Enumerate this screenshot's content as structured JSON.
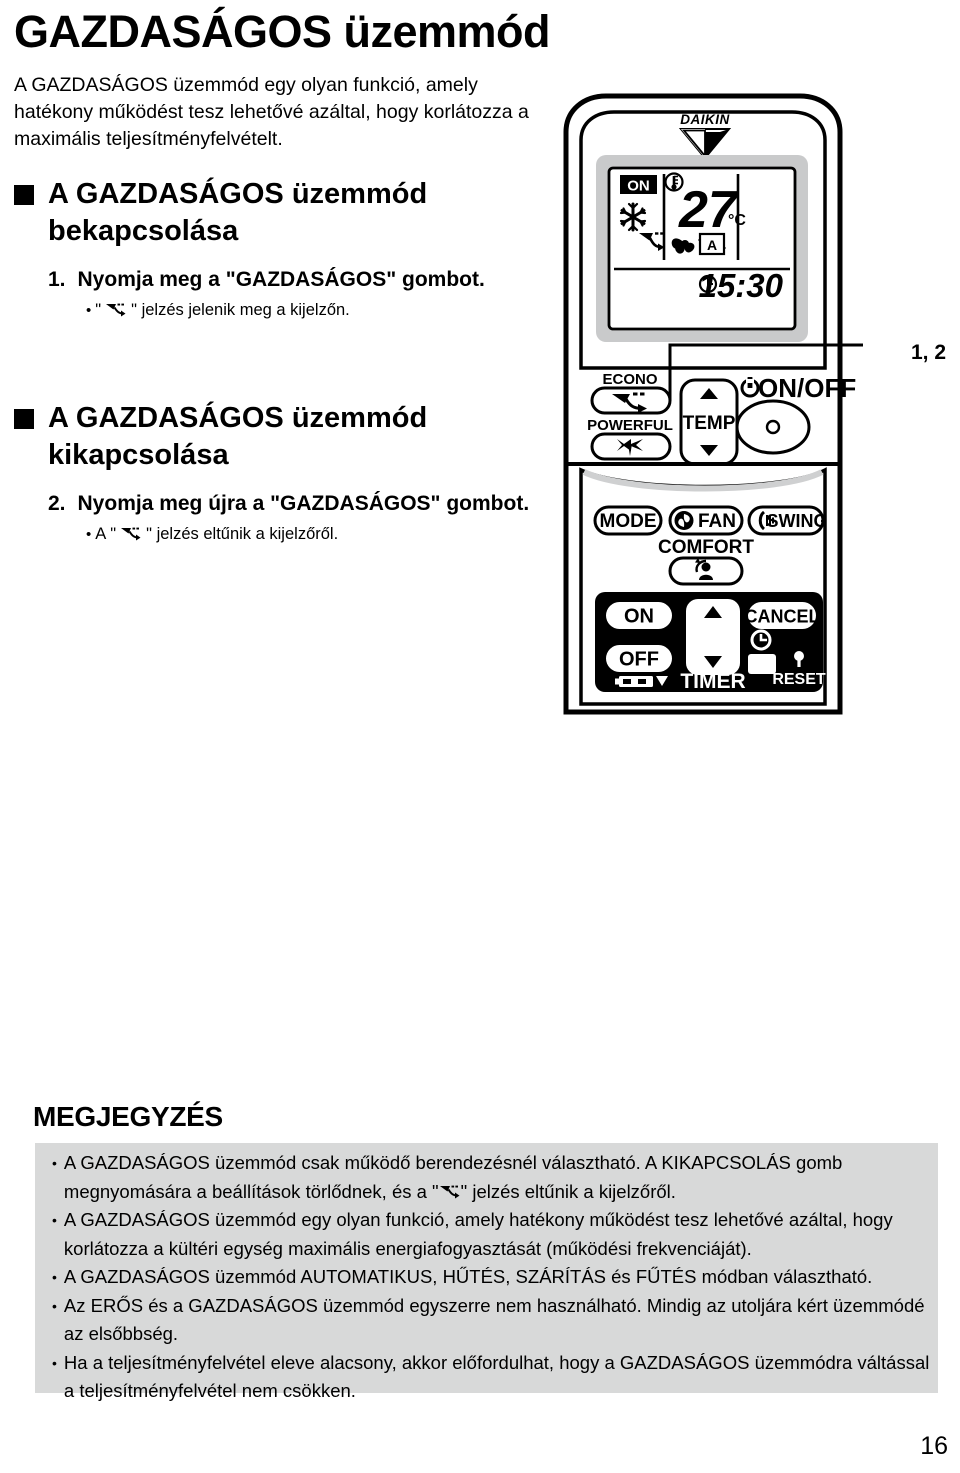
{
  "document": {
    "title": "GAZDASÁGOS üzemmód",
    "intro": "A GAZDASÁGOS üzemmód egy olyan funkció, amely hatékony működést tesz lehetővé azáltal, hogy korlátozza a maximális teljesítményfelvételt.",
    "page_number": "16"
  },
  "sections": [
    {
      "heading": "A GAZDASÁGOS üzemmód bekapcsolása",
      "step_number": "1.",
      "step_text": "Nyomja meg a \"GAZDASÁGOS\" gombot.",
      "sub_note_prefix": "\"",
      "sub_note_suffix": "\" jelzés jelenik meg a kijelzőn.",
      "sub_note_lead": ""
    },
    {
      "heading": "A GAZDASÁGOS üzemmód kikapcsolása",
      "step_number": "2.",
      "step_text": "Nyomja meg újra a \"GAZDASÁGOS\" gombot.",
      "sub_note_prefix": "\"",
      "sub_note_suffix": "\" jelzés eltűnik a kijelzőről.",
      "sub_note_lead": "A"
    }
  ],
  "callout": {
    "label": "1, 2"
  },
  "remote": {
    "brand": "DAIKIN",
    "lcd": {
      "on_badge": "ON",
      "temperature": "27",
      "temp_unit": "°C",
      "fan_mode": "A",
      "clock": "15:30",
      "icons": [
        "snowflake-icon",
        "econo-icon",
        "thermometer-icon",
        "fan-icon",
        "clock-icon"
      ]
    },
    "buttons": {
      "econo_label": "ECONO",
      "powerful_label": "POWERFUL",
      "temp_label": "TEMP",
      "onoff_label": "ON/OFF",
      "mode_label": "MODE",
      "fan_label": "FAN",
      "swing_label": "SWING",
      "comfort_label": "COMFORT",
      "timer_on_label": "ON",
      "timer_off_label": "OFF",
      "timer_label": "TIMER",
      "cancel_label": "CANCEL",
      "reset_label": "RESET"
    }
  },
  "notes": {
    "title": "MEGJEGYZÉS",
    "items": [
      {
        "text_before": "A GAZDASÁGOS üzemmód csak működő berendezésnél választható. A KIKAPCSOLÁS gomb megnyomására a beállítások törlődnek, és a \"",
        "has_icon": true,
        "text_after": "\" jelzés eltűnik a kijelzőről."
      },
      {
        "text_before": "A GAZDASÁGOS üzemmód egy olyan funkció, amely hatékony működést tesz lehetővé azáltal, hogy korlátozza a kültéri egység maximális energiafogyasztását (működési frekvenciáját).",
        "has_icon": false,
        "text_after": ""
      },
      {
        "text_before": "A GAZDASÁGOS üzemmód AUTOMATIKUS, HŰTÉS, SZÁRÍTÁS és FŰTÉS módban választható.",
        "has_icon": false,
        "text_after": ""
      },
      {
        "text_before": "Az ERŐS és a GAZDASÁGOS üzemmód egyszerre nem használható. Mindig az utoljára kért üzemmódé az elsőbbség.",
        "has_icon": false,
        "text_after": ""
      },
      {
        "text_before": "Ha a teljesítményfelvétel eleve alacsony, akkor előfordulhat, hogy a GAZDASÁGOS üzemmódra váltással a teljesítményfelvétel nem csökken.",
        "has_icon": false,
        "text_after": ""
      }
    ]
  }
}
